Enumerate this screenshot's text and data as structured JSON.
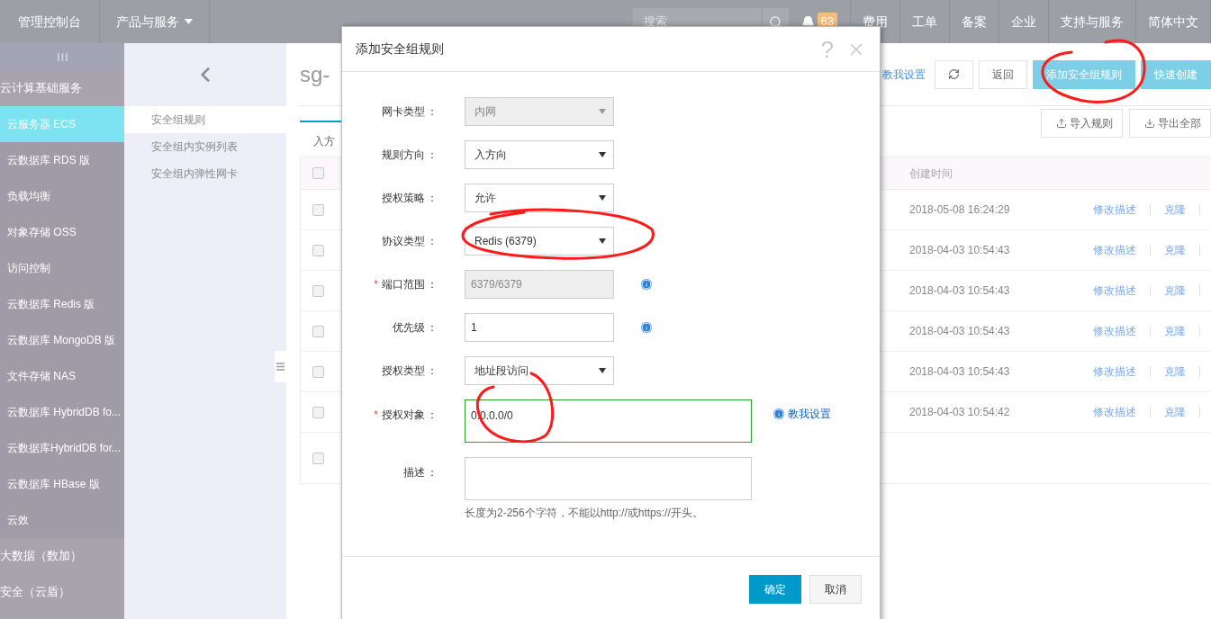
{
  "topbar": {
    "brand": "管理控制台",
    "products": "产品与服务",
    "search": {
      "placeholder": "搜索"
    },
    "notifications": "63",
    "nav": [
      "费用",
      "工单",
      "备案",
      "企业",
      "支持与服务",
      "简体中文"
    ]
  },
  "sidebar": {
    "entries": [
      {
        "kind": "header",
        "label": "云计算基础服务"
      },
      {
        "kind": "item",
        "label": "云服务器 ECS",
        "selected": true
      },
      {
        "kind": "item",
        "label": "云数据库 RDS 版",
        "selected": false
      },
      {
        "kind": "item",
        "label": "负载均衡",
        "selected": false
      },
      {
        "kind": "item",
        "label": "对象存储 OSS",
        "selected": false
      },
      {
        "kind": "item",
        "label": "访问控制",
        "selected": false
      },
      {
        "kind": "item",
        "label": "云数据库 Redis 版",
        "selected": false
      },
      {
        "kind": "item",
        "label": "云数据库 MongoDB 版",
        "selected": false
      },
      {
        "kind": "item",
        "label": "文件存储 NAS",
        "selected": false
      },
      {
        "kind": "item",
        "label": "云数据库 HybridDB fo...",
        "selected": false
      },
      {
        "kind": "item",
        "label": "云数据库HybridDB for...",
        "selected": false
      },
      {
        "kind": "item",
        "label": "云数据库 HBase 版",
        "selected": false
      },
      {
        "kind": "item",
        "label": "云效",
        "selected": false
      },
      {
        "kind": "header",
        "label": "大数据（数加）"
      },
      {
        "kind": "header",
        "label": "安全（云盾）"
      }
    ]
  },
  "subnav": {
    "items": [
      {
        "label": "安全组规则",
        "selected": true
      },
      {
        "label": "安全组内实例列表",
        "selected": false
      },
      {
        "label": "安全组内弹性网卡",
        "selected": false
      }
    ]
  },
  "main": {
    "title": "sg-",
    "help_link": "教我设置",
    "actions": [
      {
        "kind": "refresh"
      },
      {
        "kind": "default",
        "label": "返回"
      },
      {
        "kind": "primary",
        "label": "添加安全组规则"
      },
      {
        "kind": "primary",
        "label": "快速创建"
      }
    ],
    "tabs": [
      {
        "label": "入方",
        "selected": true
      }
    ],
    "tools": [
      {
        "kind": "import",
        "label": "导入规则"
      },
      {
        "kind": "export",
        "label": "导出全部"
      }
    ],
    "table": {
      "header_checked": false,
      "time_header": "创建时间",
      "rows": [
        {
          "checked": false,
          "created": "2018-05-08 16:24:29",
          "actions": [
            "修改描述",
            "克隆"
          ]
        },
        {
          "checked": false,
          "created": "2018-04-03 10:54:43",
          "actions": [
            "修改描述",
            "克隆"
          ]
        },
        {
          "checked": false,
          "created": "2018-04-03 10:54:43",
          "actions": [
            "修改描述",
            "克隆"
          ]
        },
        {
          "checked": false,
          "created": "2018-04-03 10:54:43",
          "actions": [
            "修改描述",
            "克隆"
          ]
        },
        {
          "checked": false,
          "created": "2018-04-03 10:54:43",
          "actions": [
            "修改描述",
            "克隆"
          ]
        },
        {
          "checked": false,
          "created": "2018-04-03 10:54:42",
          "actions": [
            "修改描述",
            "克隆"
          ]
        }
      ],
      "footer_checked": false
    }
  },
  "dialog": {
    "title": "添加安全组规则",
    "help": "?",
    "required_mark": "*",
    "label_suffix": "：",
    "fields": [
      {
        "kind": "select",
        "label": "网卡类型",
        "value": "内网",
        "disabled": true,
        "required": false,
        "info": false
      },
      {
        "kind": "select",
        "label": "规则方向",
        "value": "入方向",
        "disabled": false,
        "required": false,
        "info": false
      },
      {
        "kind": "select",
        "label": "授权策略",
        "value": "允许",
        "disabled": false,
        "required": false,
        "info": false
      },
      {
        "kind": "select",
        "label": "协议类型",
        "value": "Redis (6379)",
        "disabled": false,
        "required": false,
        "info": false
      },
      {
        "kind": "input",
        "label": "端口范围",
        "value": "6379/6379",
        "disabled": true,
        "required": true,
        "info": true
      },
      {
        "kind": "input",
        "label": "优先级",
        "value": "1",
        "disabled": false,
        "required": false,
        "info": true
      },
      {
        "kind": "select",
        "label": "授权类型",
        "value": "地址段访问",
        "disabled": false,
        "required": false,
        "info": false
      },
      {
        "kind": "textarea",
        "label": "授权对象",
        "value": "0.0.0.0/0",
        "disabled": false,
        "required": true,
        "info": true,
        "valid": true,
        "link": "教我设置"
      },
      {
        "kind": "textarea",
        "label": "描述",
        "disabled": false,
        "required": false,
        "info": false,
        "hint": "长度为2-256个字符，不能以http://或https://开头。"
      }
    ],
    "buttons": [
      {
        "kind": "primary",
        "label": "确定"
      },
      {
        "kind": "default",
        "label": "取消"
      }
    ]
  }
}
